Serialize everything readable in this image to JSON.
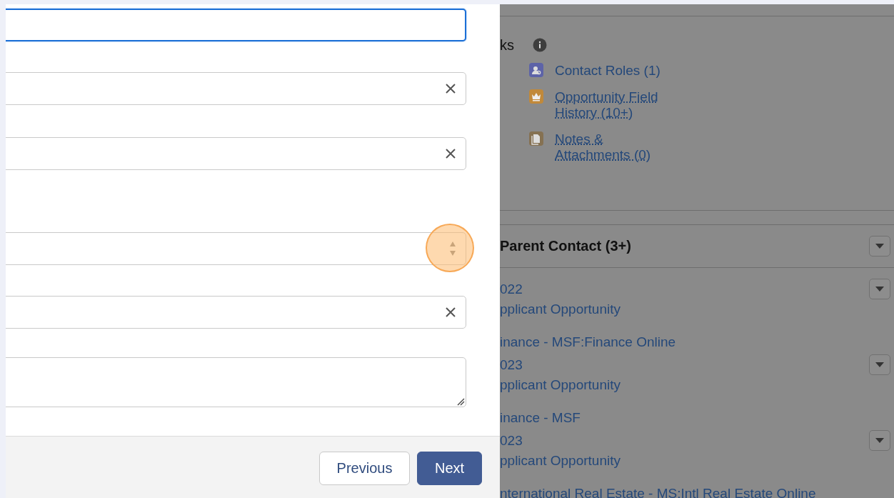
{
  "form": {
    "fields": [
      {
        "kind": "text",
        "focused": true,
        "highlighted": false
      },
      {
        "kind": "lookup",
        "focused": false,
        "highlighted": false
      },
      {
        "kind": "lookup",
        "focused": false,
        "highlighted": false
      },
      {
        "kind": "picklist",
        "focused": false,
        "highlighted": true
      },
      {
        "kind": "lookup",
        "focused": false,
        "highlighted": false
      },
      {
        "kind": "textarea",
        "focused": false,
        "highlighted": false
      }
    ],
    "buttons": [
      {
        "label": "Previous",
        "kind": "neutral"
      },
      {
        "label": "Next",
        "kind": "brand"
      }
    ]
  },
  "related_links": {
    "title": "ks",
    "items": [
      {
        "label": "Contact Roles (1)",
        "kind": "contact",
        "color": "#5d63a8",
        "underlined": false
      },
      {
        "label": "Opportunity Field History (10+)",
        "kind": "crown",
        "color": "#c1893a",
        "underlined": true
      },
      {
        "label": "Notes & Attachments (0)",
        "kind": "notes",
        "color": "#857152",
        "underlined": true
      }
    ]
  },
  "related_list": {
    "title": "Parent Contact (3+)",
    "records": [
      {
        "title": "022",
        "fields": [
          "pplicant Opportunity",
          "inance - MSF:Finance Online"
        ]
      },
      {
        "title": "023",
        "fields": [
          "pplicant Opportunity",
          "inance - MSF"
        ]
      },
      {
        "title": "023",
        "fields": [
          "pplicant Opportunity",
          "nternational Real Estate - MS:Intl Real Estate Online"
        ]
      }
    ]
  }
}
